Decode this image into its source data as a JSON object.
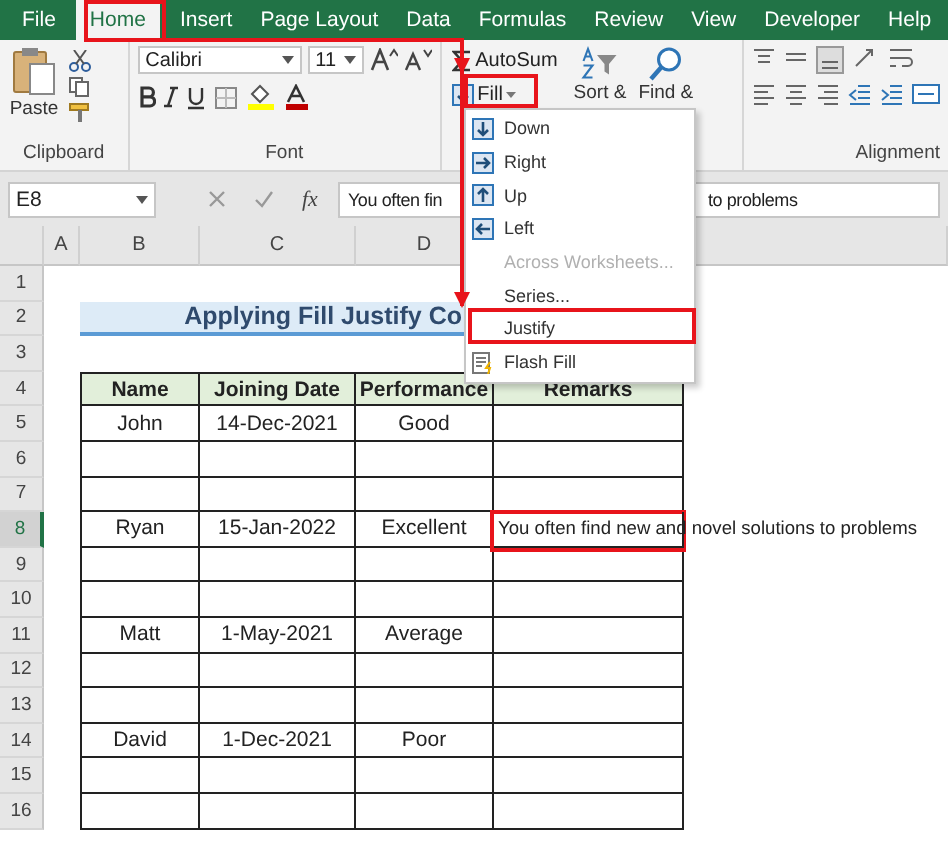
{
  "tabs": [
    {
      "label": "File",
      "selected": false
    },
    {
      "label": "Home",
      "selected": true
    },
    {
      "label": "Insert",
      "selected": false
    },
    {
      "label": "Page Layout",
      "selected": false
    },
    {
      "label": "Data",
      "selected": false
    },
    {
      "label": "Formulas",
      "selected": false
    },
    {
      "label": "Review",
      "selected": false
    },
    {
      "label": "View",
      "selected": false
    },
    {
      "label": "Developer",
      "selected": false
    },
    {
      "label": "Help",
      "selected": false
    }
  ],
  "ribbon": {
    "clipboard": {
      "paste": "Paste",
      "group_label": "Clipboard"
    },
    "font": {
      "font_name": "Calibri",
      "font_size": "11",
      "group_label": "Font"
    },
    "editing": {
      "autosum": "AutoSum",
      "fill": "Fill",
      "sort": "Sort &",
      "find": "Find &"
    },
    "alignment": {
      "group_label": "Alignment"
    }
  },
  "formula_bar": {
    "name_box": "E8",
    "fx": "fx",
    "text_start": "You often fin",
    "text_end": "to problems"
  },
  "fill_menu": [
    {
      "label": "Down",
      "kind": "direction",
      "disabled": false
    },
    {
      "label": "Right",
      "kind": "direction",
      "disabled": false
    },
    {
      "label": "Up",
      "kind": "direction",
      "disabled": false
    },
    {
      "label": "Left",
      "kind": "direction",
      "disabled": false
    },
    {
      "label": "Across Worksheets...",
      "kind": "command",
      "disabled": true
    },
    {
      "label": "Series...",
      "kind": "command",
      "disabled": false
    },
    {
      "label": "Justify",
      "kind": "command",
      "disabled": false
    },
    {
      "label": "Flash Fill",
      "kind": "flash",
      "disabled": false
    }
  ],
  "sheet": {
    "columns": [
      {
        "label": "A",
        "selected": false
      },
      {
        "label": "B",
        "selected": false
      },
      {
        "label": "C",
        "selected": false
      },
      {
        "label": "D",
        "selected": false
      }
    ],
    "rows": [
      {
        "label": "1",
        "selected": false
      },
      {
        "label": "2",
        "selected": false
      },
      {
        "label": "3",
        "selected": false
      },
      {
        "label": "4",
        "selected": false
      },
      {
        "label": "5",
        "selected": false
      },
      {
        "label": "6",
        "selected": false
      },
      {
        "label": "7",
        "selected": false
      },
      {
        "label": "8",
        "selected": true
      },
      {
        "label": "9",
        "selected": false
      },
      {
        "label": "10",
        "selected": false
      },
      {
        "label": "11",
        "selected": false
      },
      {
        "label": "12",
        "selected": false
      },
      {
        "label": "13",
        "selected": false
      },
      {
        "label": "14",
        "selected": false
      },
      {
        "label": "15",
        "selected": false
      },
      {
        "label": "16",
        "selected": false
      }
    ],
    "title": "Applying Fill Justify Co",
    "headers": [
      "Name",
      "Joining Date",
      "Performance",
      "Remarks"
    ],
    "records": [
      {
        "name": "John",
        "joining_date": "14-Dec-2021",
        "performance": "Good"
      },
      {
        "name": "Ryan",
        "joining_date": "15-Jan-2022",
        "performance": "Excellent",
        "remarks": "You often find new and novel solutions to problems"
      },
      {
        "name": "Matt",
        "joining_date": "1-May-2021",
        "performance": "Average"
      },
      {
        "name": "David",
        "joining_date": "1-Dec-2021",
        "performance": "Poor"
      }
    ]
  }
}
